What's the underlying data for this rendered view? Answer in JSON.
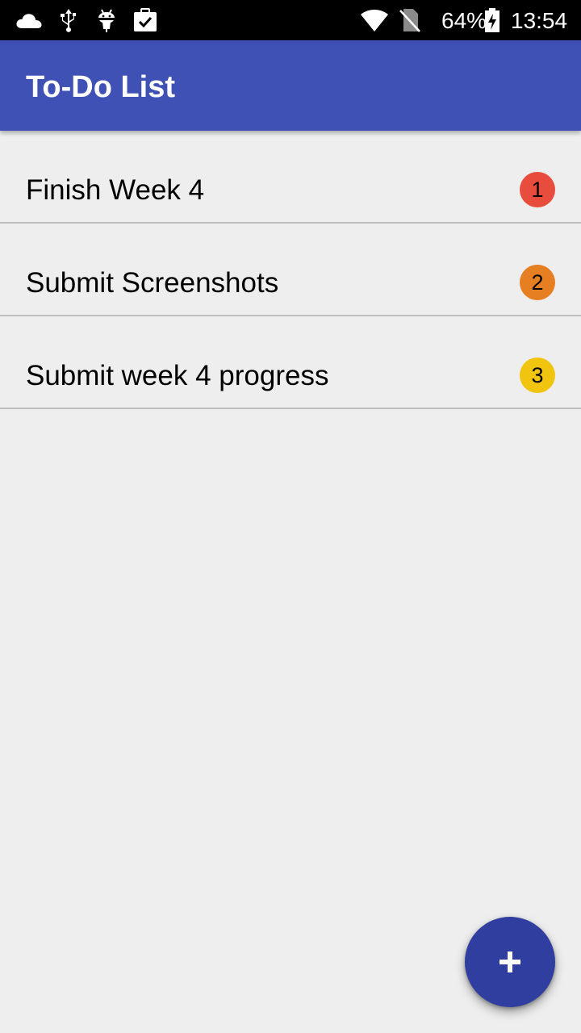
{
  "status_bar": {
    "battery_percent": "64%",
    "time": "13:54",
    "icons": [
      "cloud-icon",
      "usb-icon",
      "android-debug-icon",
      "task-check-icon",
      "wifi-icon",
      "no-sim-icon",
      "battery-charging-icon"
    ]
  },
  "app_bar": {
    "title": "To-Do List",
    "color": "#3f51b5"
  },
  "todos": [
    {
      "label": "Finish Week 4",
      "priority": "1",
      "color": "#e84c3d"
    },
    {
      "label": "Submit Screenshots",
      "priority": "2",
      "color": "#e67e22"
    },
    {
      "label": "Submit week 4 progress",
      "priority": "3",
      "color": "#f1c40f"
    }
  ],
  "fab": {
    "icon": "plus-icon",
    "color": "#303f9f"
  }
}
